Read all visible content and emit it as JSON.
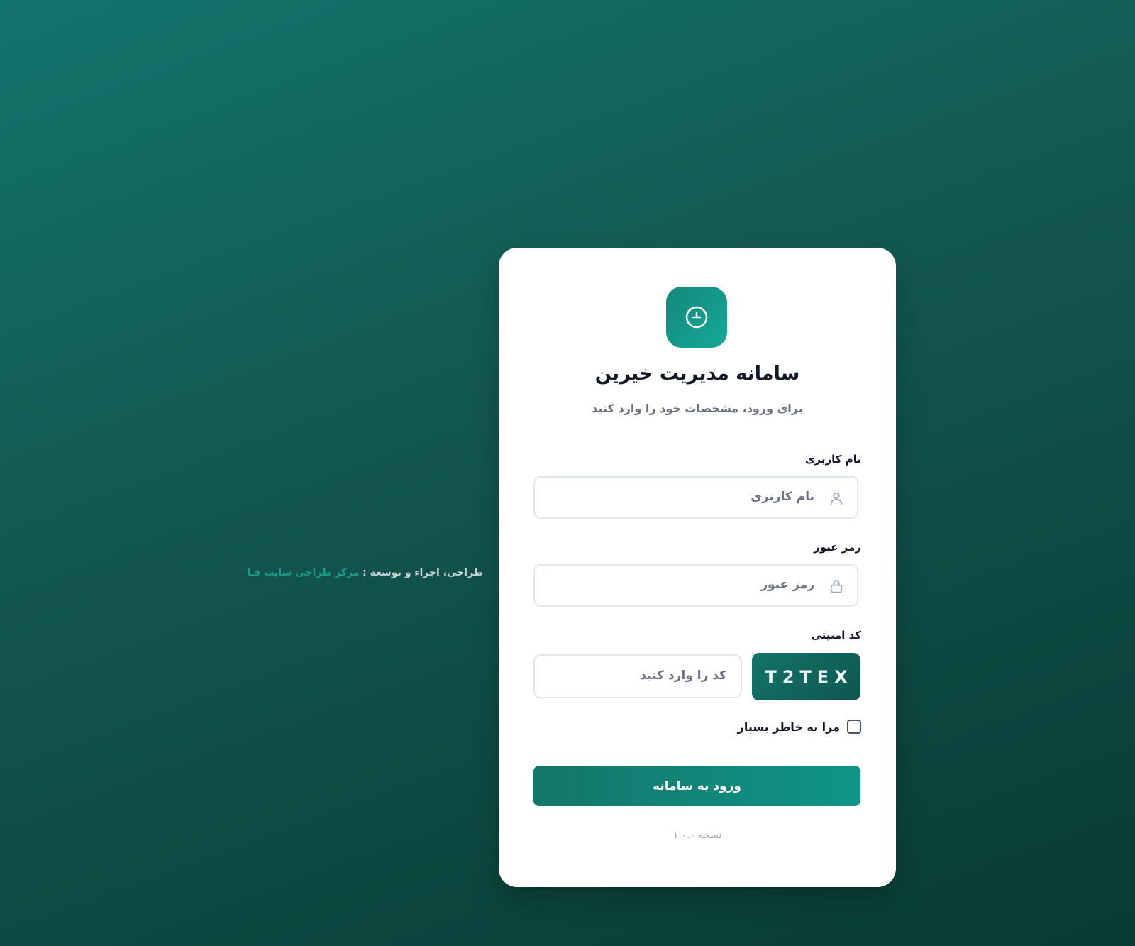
{
  "app": {
    "title": "سامانه مدیریت خیرین",
    "subtitle": "برای ورود، مشخصات خود را وارد کنید",
    "logo_icon": "clock-icon"
  },
  "form": {
    "username": {
      "label": "نام کاربری",
      "placeholder": "نام کاربری",
      "value": "",
      "icon": "user-icon"
    },
    "password": {
      "label": "رمز عبور",
      "placeholder": "رمز عبور",
      "value": "",
      "icon": "lock-icon"
    },
    "captcha": {
      "label": "کد امنیتی",
      "placeholder": "کد را وارد کنید",
      "value": "",
      "code": "T2TEX"
    },
    "remember": {
      "label": "مرا به خاطر بسپار",
      "checked": false
    },
    "submit_label": "ورود به سامانه"
  },
  "version": "نسخه ۱.۰.۰",
  "credit": {
    "prefix": "طراحی، اجراء و توسعه : ",
    "link_text": "مرکز طراحی سایت فـا"
  },
  "colors": {
    "accent": "#13756a",
    "accent_light": "#14aa98",
    "background_dark": "#083a34"
  }
}
